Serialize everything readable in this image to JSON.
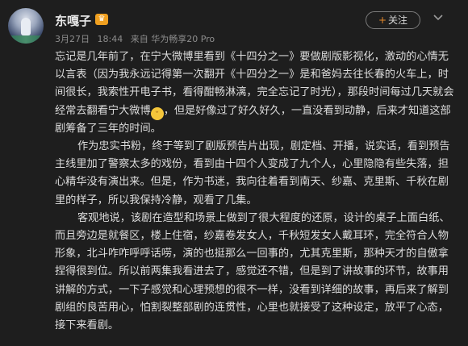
{
  "header": {
    "username": "东嘎子",
    "vip_badge": "♛",
    "date": "3月27日",
    "time": "18:44",
    "source": "来自 华为畅享20 Pro",
    "follow_label": "关注",
    "follow_icon": "+",
    "more_icon": "chevron-down-icon"
  },
  "post": {
    "p1_a": "忘记是几年前了，在宁大微博里看到《十四分之一》要做剧版影视化，激动的心情无以言表（因为我永远记得第一次翻开《十四分之一》是和爸妈去往长春的火车上，时间很长，我索性开电子书，看得酣畅淋漓，完全忘记了时光），那段时间每过几天就会经常去翻看宁大微博",
    "p1_emoji": "grin-emoji",
    "p1_b": "，但是好像过了好久好久，一直没看到动静，后来才知道这部剧筹备了三年的时间。",
    "p2": "作为忠实书粉，终于等到了剧版预告片出现，剧定档、开播，说实话，看到预告主线里加了警察太多的戏份，看到由十四个人变成了九个人，心里隐隐有些失落，担心精华没有演出来。但是，作为书迷，我向往着看到南天、纱嘉、克里斯、千秋在剧里的样子，所以我保持冷静，观看了几集。",
    "p3": "客观地说，该剧在造型和场景上做到了很大程度的还原，设计的桌子上面白纸、而且旁边是就餐区，楼上住宿，纱嘉卷发女人，千秋短发女人戴耳环，完全符合人物形象，北斗咋咋呼呼话唠，演的也挺那么一回事的，尤其克里斯，那种天才的自傲拿捏得很到位。所以前两集我看进去了，感觉还不错，但是到了讲故事的环节，故事用讲解的方式，一下子感觉和心理预想的很不一样，没看到详细的故事，再后来了解到剧组的良苦用心，怕割裂整部剧的连贯性，心里也就接受了这种设定，放平了心态，接下来看剧。"
  },
  "colors": {
    "background": "#1e1e1e",
    "text": "#dcdcdc",
    "meta": "#8d8d8d",
    "accent": "#e88a2a"
  }
}
